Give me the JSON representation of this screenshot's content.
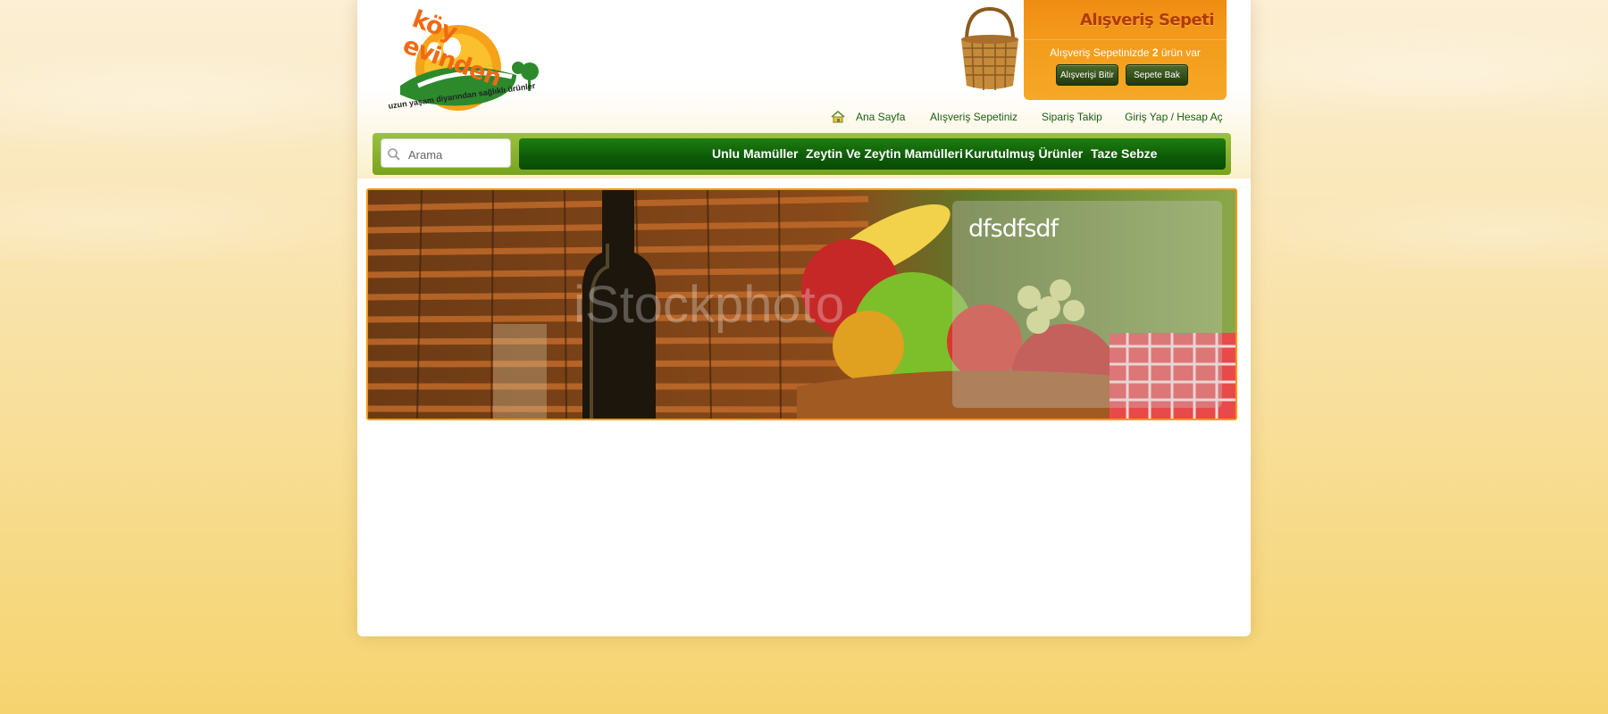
{
  "logo": {
    "brand": "köy evinden",
    "tagline": "uzun yaşam diyarından sağlıklı ürünler"
  },
  "cart": {
    "title": "Alışveriş Sepeti",
    "info_prefix": "Alışveriş Sepetinizde",
    "count": "2",
    "info_suffix": "ürün var",
    "finish_button": "Alışverişi Bitir",
    "view_button": "Sepete Bak"
  },
  "toplinks": {
    "home": "Ana Sayfa",
    "cart": "Alışveriş Sepetiniz",
    "order_tracking": "Sipariş Takip",
    "login": "Giriş Yap / Hesap Aç"
  },
  "search": {
    "placeholder": "Arama"
  },
  "menu": {
    "items": [
      "Unlu Mamüller",
      "Zeytin Ve Zeytin Mamülleri",
      "Kurutulmuş Ürünler",
      "Taze Sebze"
    ]
  },
  "banner": {
    "caption_title": "dfsdfsdf",
    "watermark": "iStockphoto"
  },
  "colors": {
    "accent_orange": "#f39a1b",
    "nav_green": "#0e5a07",
    "link_green": "#195e10"
  }
}
